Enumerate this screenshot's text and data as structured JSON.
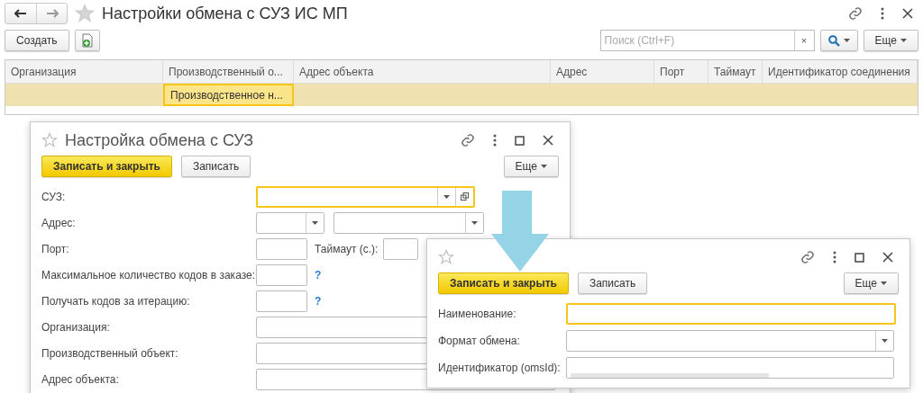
{
  "window": {
    "title": "Настройки обмена с СУЗ ИС МП"
  },
  "toolbar": {
    "create_button": "Создать",
    "search": {
      "placeholder": "Поиск (Ctrl+F)"
    },
    "clear_glyph": "×",
    "more_button": "Еще"
  },
  "table": {
    "columns": [
      "Организация",
      "Производственный о...",
      "Адрес объекта",
      "Адрес",
      "Порт",
      "Таймаут",
      "Идентификатор соединения"
    ],
    "rows": [
      {
        "selected": true,
        "cells": [
          {
            "focused": false
          },
          {
            "text": "Производственное н...",
            "focused": true
          },
          {
            "focused": false
          },
          {
            "focused": false
          },
          {
            "focused": false
          },
          {
            "focused": false
          },
          {
            "focused": false
          }
        ]
      }
    ]
  },
  "dialogs": [
    {
      "title": "Настройка обмена с СУЗ",
      "buttons": [
        {
          "label": "Записать и закрыть",
          "primary": true
        },
        {
          "label": "Записать",
          "primary": false
        }
      ],
      "more_button": "Еще",
      "fields": [
        {
          "label": "СУЗ:",
          "kind": "chooser",
          "focused": true
        },
        {
          "label": "Адрес:",
          "kind": "select-pair",
          "focused": false
        },
        {
          "label": "Порт:",
          "kind": "short-pair",
          "second_label": "Таймаут (с.):",
          "focused": false
        },
        {
          "label": "Максимальное количество кодов в заказе:",
          "kind": "short",
          "help": "?",
          "focused": false
        },
        {
          "label": "Получать кодов за итерацию:",
          "kind": "short",
          "help": "?",
          "focused": false
        },
        {
          "label": "Организация:",
          "kind": "text",
          "focused": false
        },
        {
          "label": "Производственный объект:",
          "kind": "text",
          "focused": false
        },
        {
          "label": "Адрес объекта:",
          "kind": "text",
          "focused": false
        }
      ]
    },
    {
      "buttons": [
        {
          "label": "Записать и закрыть",
          "primary": true
        },
        {
          "label": "Записать",
          "primary": false
        }
      ],
      "more_button": "Еще",
      "fields": [
        {
          "label": "Наименование:",
          "kind": "text",
          "focused": true
        },
        {
          "label": "Формат обмена:",
          "kind": "select",
          "focused": false
        },
        {
          "label": "Идентификатор (omsId):",
          "kind": "redacted",
          "focused": false
        }
      ]
    }
  ]
}
